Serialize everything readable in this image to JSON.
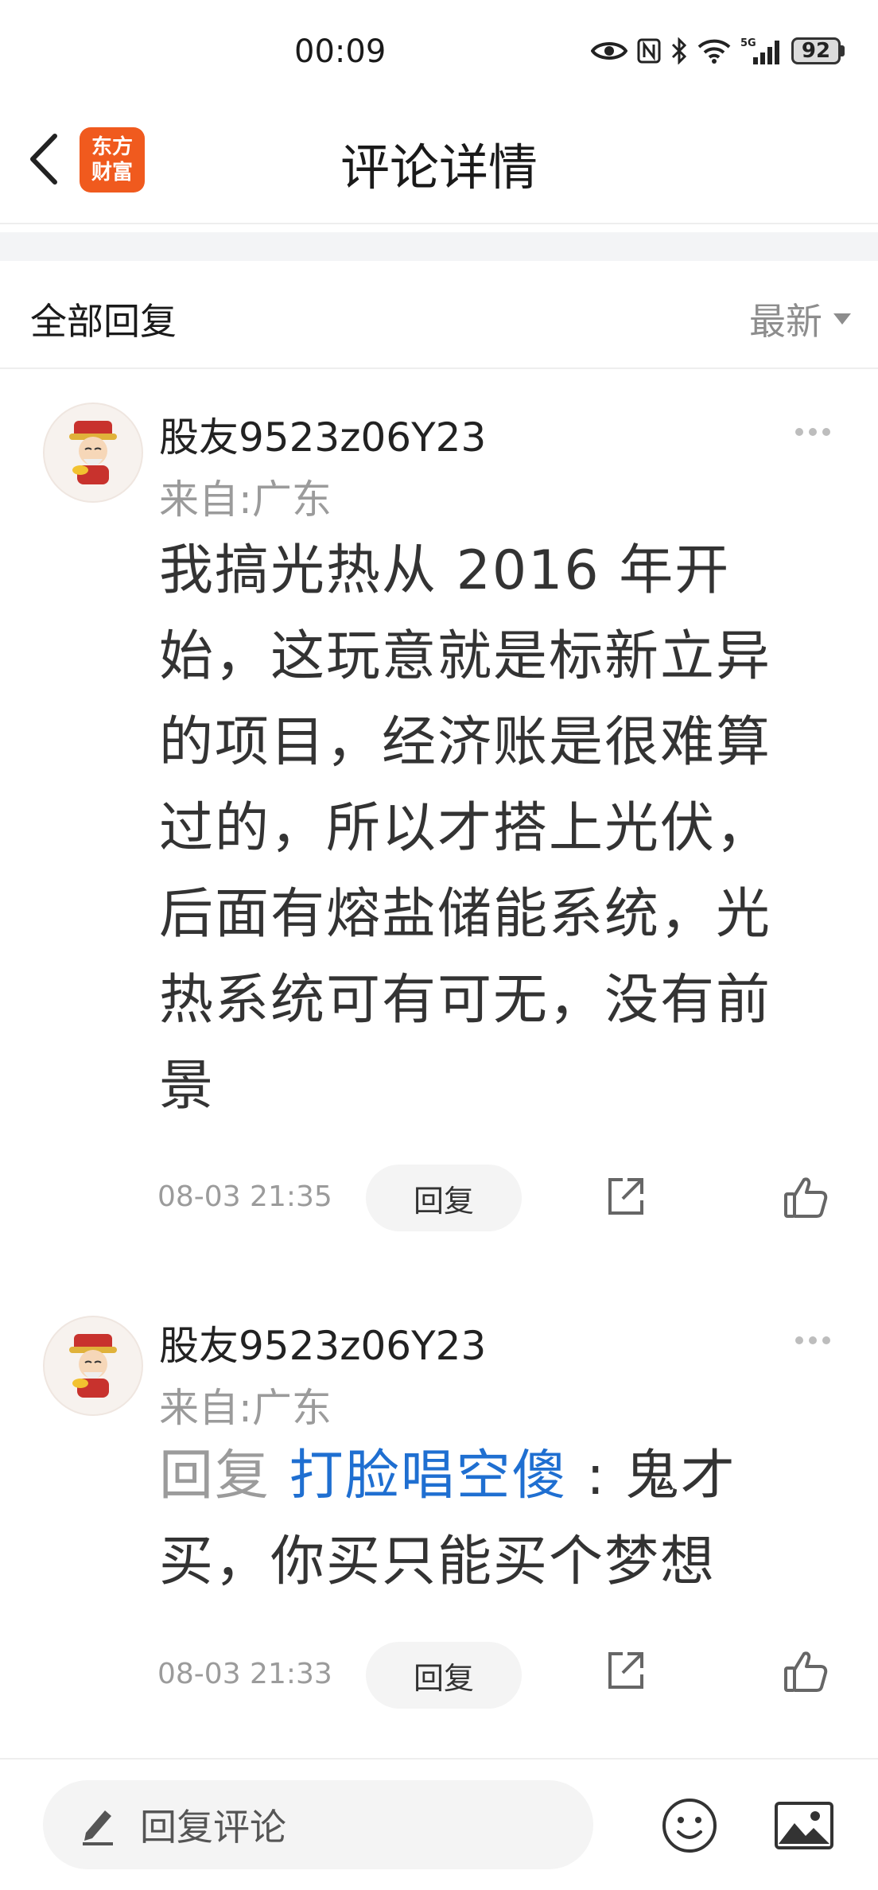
{
  "status_bar": {
    "time": "00:09",
    "battery": "92",
    "network": "5G",
    "icons": [
      "eye-icon",
      "nfc-icon",
      "bluetooth-icon",
      "wifi-icon",
      "signal-icon",
      "battery-icon"
    ]
  },
  "header": {
    "title": "评论详情",
    "logo_line1": "东方",
    "logo_line2": "财富",
    "logo_color": "#f05a1e"
  },
  "section": {
    "title": "全部回复",
    "sort": "最新"
  },
  "comments": [
    {
      "username": "股友9523z06Y23",
      "location": "来自:广东",
      "text": "我搞光热从 2016 年开始，这玩意就是标新立异的项目，经济账是很难算过的，所以才搭上光伏，后面有熔盐储能系统，光热系统可有可无，没有前景",
      "time": "08-03 21:35",
      "reply_label": "回复"
    },
    {
      "username": "股友9523z06Y23",
      "location": "来自:广东",
      "reply_prefix": "回复 ",
      "mention": "打脸唱空傻",
      "separator": " : ",
      "text": "鬼才买，你买只能买个梦想",
      "time": "08-03 21:33",
      "reply_label": "回复"
    }
  ],
  "bottom_bar": {
    "placeholder": "回复评论"
  },
  "colors": {
    "accent_blue": "#1f6fd1",
    "muted_gray": "#9b9b9b"
  }
}
